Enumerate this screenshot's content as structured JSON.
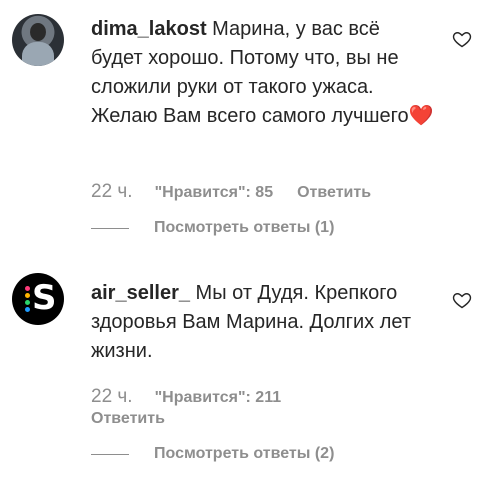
{
  "comments": [
    {
      "username": "dima_lakost",
      "text": "Марина, у вас всё будет хорошо. Потому что, вы не сложили руки от такого ужаса. Желаю Вам всего самого лучшего",
      "emoji": "❤️",
      "time": "22 ч.",
      "likes": "\"Нравится\": 85",
      "reply_label": "Ответить",
      "view_replies": "Посмотреть ответы (1)"
    },
    {
      "username": "air_seller_",
      "text": "Мы от Дудя. Крепкого здоровья Вам Марина. Долгих лет жизни.",
      "time": "22 ч.",
      "likes": "\"Нравится\": 211",
      "reply_label": "Ответить",
      "view_replies": "Посмотреть ответы (2)",
      "avatar_letter": "S",
      "avatar_dot_colors": [
        "#ff3b7a",
        "#ffb400",
        "#2bd56b",
        "#1e9bff"
      ]
    }
  ]
}
